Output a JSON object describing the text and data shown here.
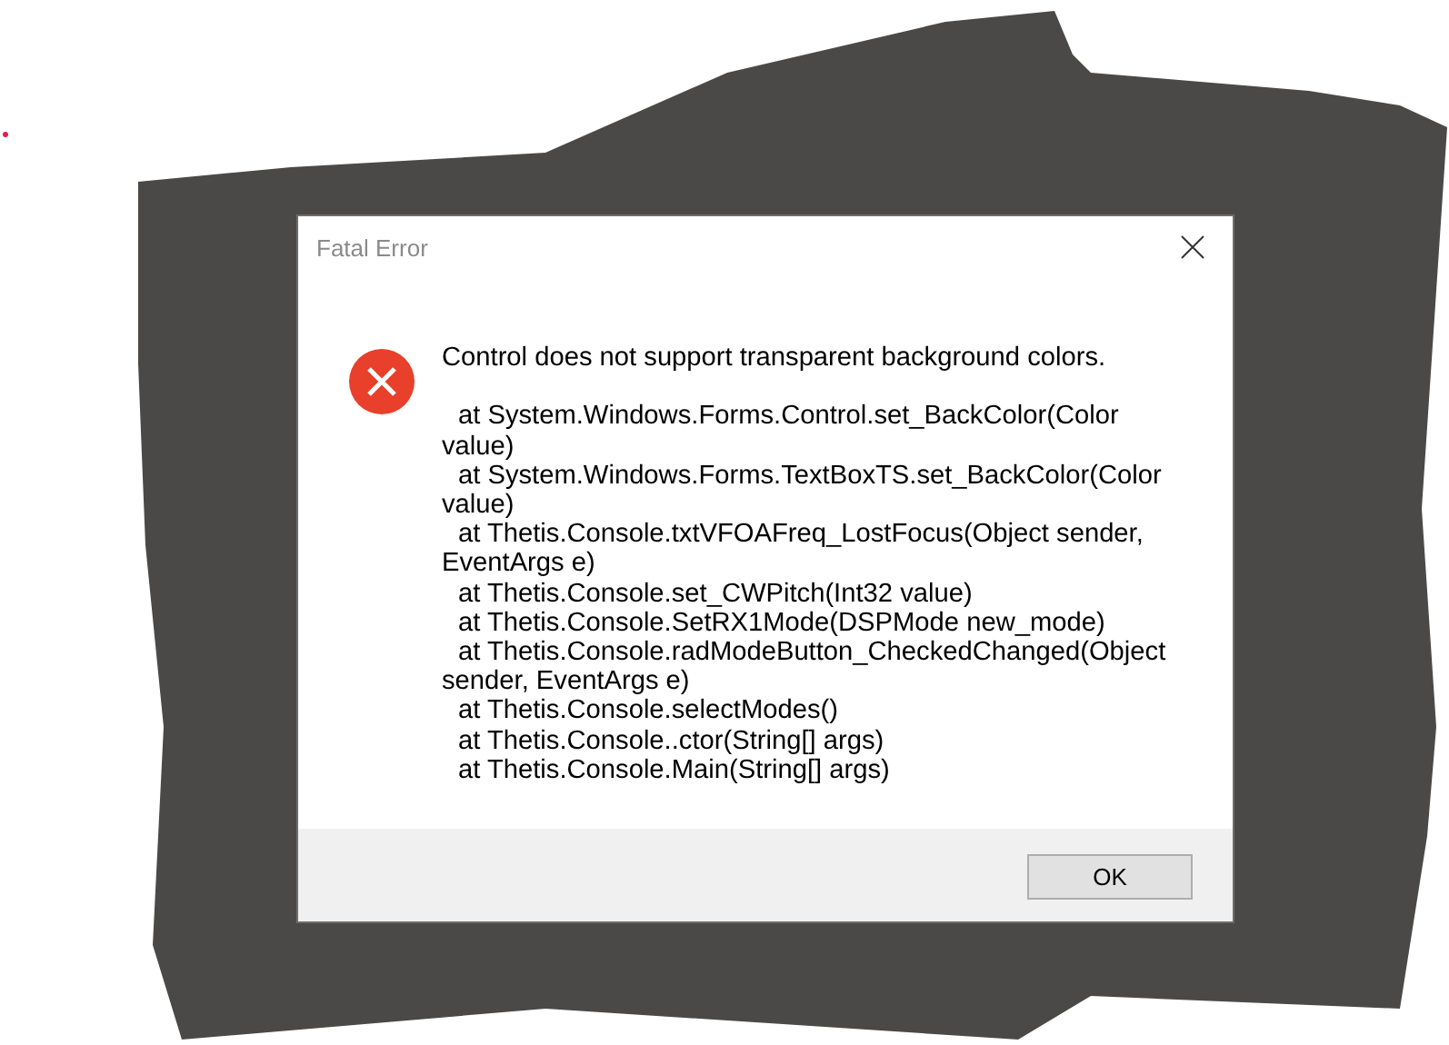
{
  "dialog": {
    "title": "Fatal Error",
    "kind": "error",
    "message": "Control does not support transparent background colors.",
    "stack_trace": [
      "at System.Windows.Forms.Control.set_BackColor(Color value)",
      "at System.Windows.Forms.TextBoxTS.set_BackColor(Color value)",
      "at Thetis.Console.txtVFOAFreq_LostFocus(Object sender, EventArgs e)",
      "at Thetis.Console.set_CWPitch(Int32 value)",
      "at Thetis.Console.SetRX1Mode(DSPMode new_mode)",
      "at Thetis.Console.radModeButton_CheckedChanged(Object sender, EventArgs e)",
      "at Thetis.Console.selectModes()",
      "at Thetis.Console..ctor(String[] args)",
      "at Thetis.Console.Main(String[] args)"
    ],
    "buttons": [
      "OK"
    ]
  }
}
